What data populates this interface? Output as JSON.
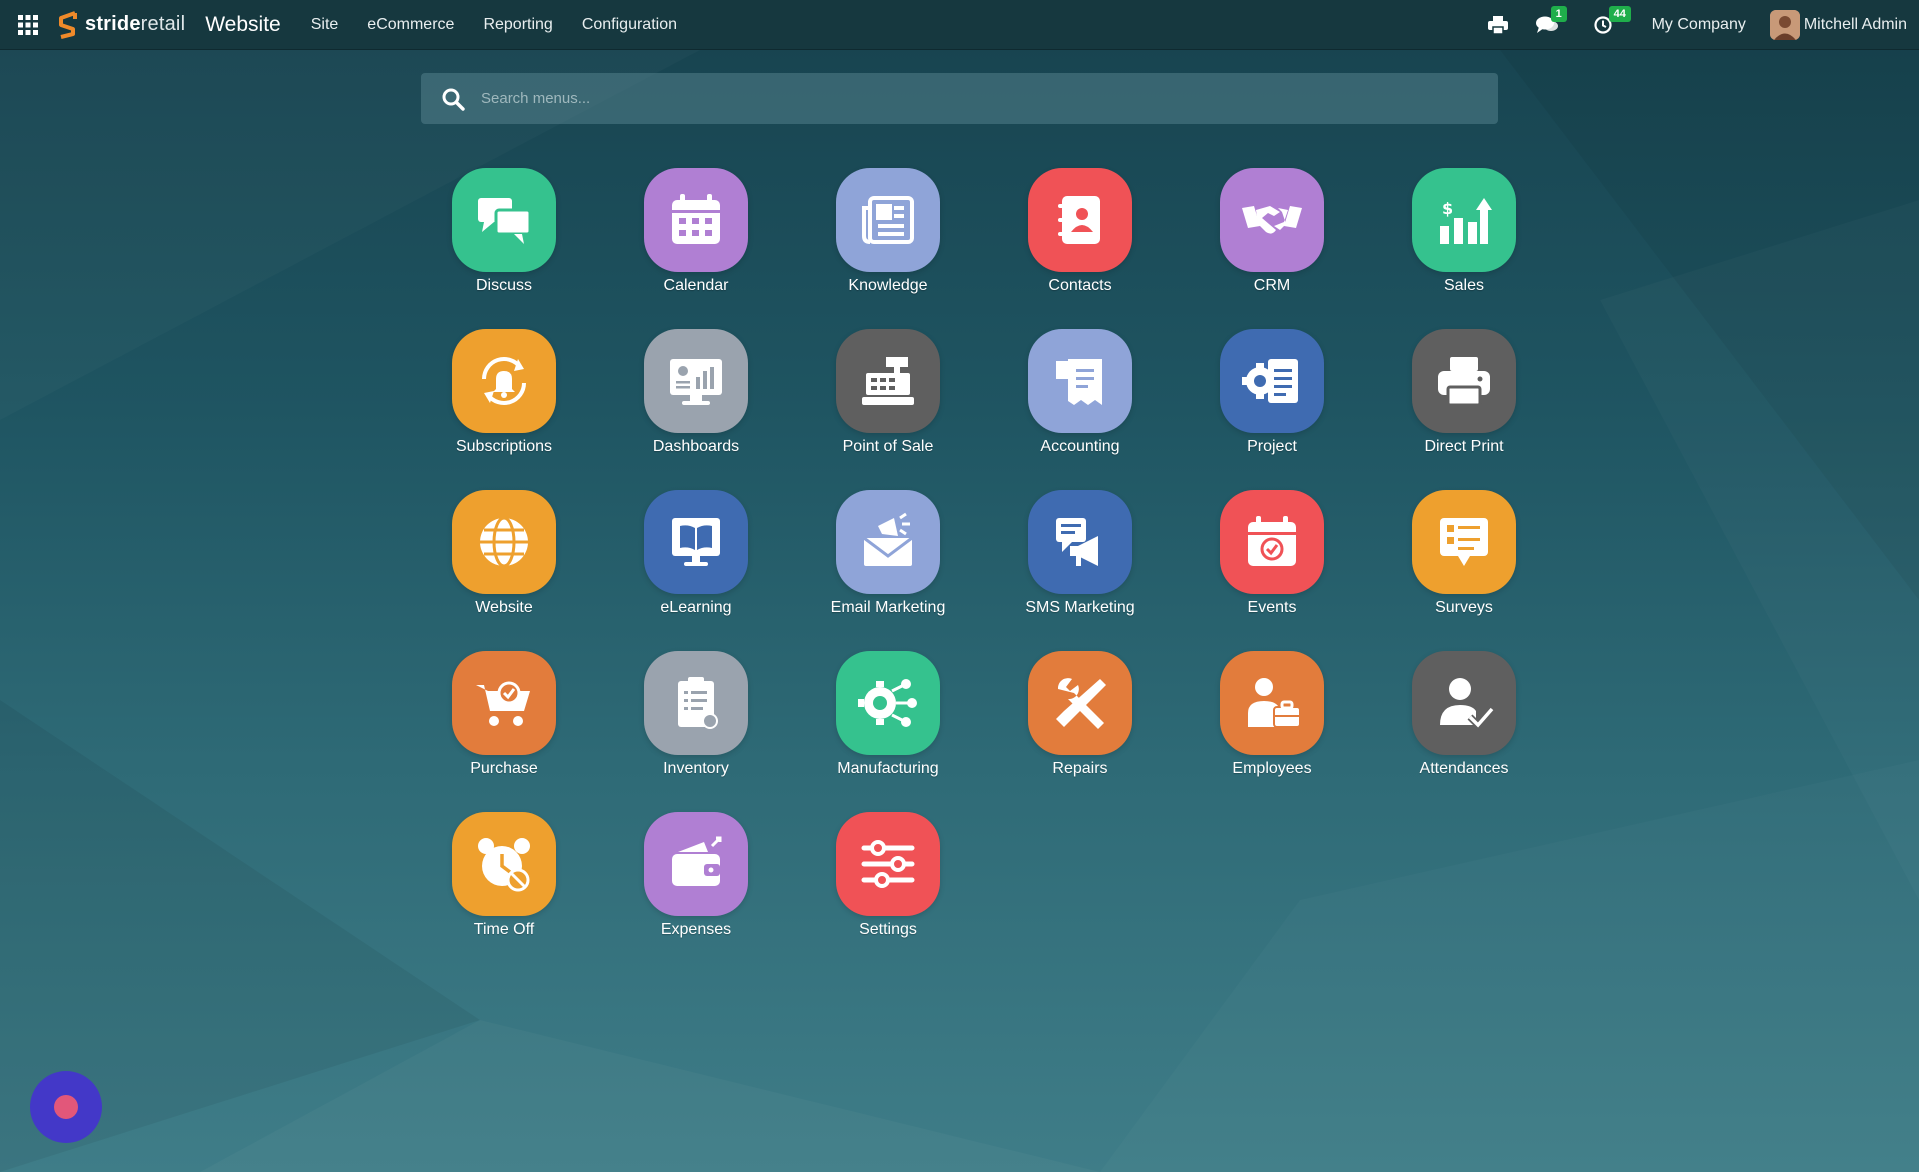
{
  "navbar": {
    "brand": {
      "bold": "stride",
      "light": "retail"
    },
    "app_title": "Website",
    "menu": [
      {
        "label": "Site"
      },
      {
        "label": "eCommerce"
      },
      {
        "label": "Reporting"
      },
      {
        "label": "Configuration"
      }
    ],
    "messages_badge": "1",
    "activities_badge": "44",
    "company": "My Company",
    "user_name": "Mitchell Admin"
  },
  "search": {
    "placeholder": "Search menus..."
  },
  "apps": [
    {
      "label": "Discuss",
      "color": "#35c28e",
      "icon": "chat-bubbles-icon"
    },
    {
      "label": "Calendar",
      "color": "#b07fd3",
      "icon": "calendar-icon"
    },
    {
      "label": "Knowledge",
      "color": "#8fa4d8",
      "icon": "newspaper-icon"
    },
    {
      "label": "Contacts",
      "color": "#f05256",
      "icon": "address-book-icon"
    },
    {
      "label": "CRM",
      "color": "#b07fd3",
      "icon": "handshake-icon"
    },
    {
      "label": "Sales",
      "color": "#35c28e",
      "icon": "chart-growth-icon"
    },
    {
      "label": "Subscriptions",
      "color": "#eea02e",
      "icon": "bell-cycle-icon"
    },
    {
      "label": "Dashboards",
      "color": "#9aa3ae",
      "icon": "monitor-chart-icon"
    },
    {
      "label": "Point of Sale",
      "color": "#5f5f5f",
      "icon": "cash-register-icon"
    },
    {
      "label": "Accounting",
      "color": "#8fa4d8",
      "icon": "receipt-icon"
    },
    {
      "label": "Project",
      "color": "#3f6bb1",
      "icon": "project-gear-icon"
    },
    {
      "label": "Direct Print",
      "color": "#5f5f5f",
      "icon": "printer-icon"
    },
    {
      "label": "Website",
      "color": "#eea02e",
      "icon": "globe-icon"
    },
    {
      "label": "eLearning",
      "color": "#3f6bb1",
      "icon": "open-book-icon"
    },
    {
      "label": "Email Marketing",
      "color": "#8fa4d8",
      "icon": "envelope-megaphone-icon"
    },
    {
      "label": "SMS Marketing",
      "color": "#3f6bb1",
      "icon": "sms-megaphone-icon"
    },
    {
      "label": "Events",
      "color": "#f05256",
      "icon": "calendar-check-icon"
    },
    {
      "label": "Surveys",
      "color": "#eea02e",
      "icon": "survey-icon"
    },
    {
      "label": "Purchase",
      "color": "#e27c3c",
      "icon": "shopping-cart-icon"
    },
    {
      "label": "Inventory",
      "color": "#9aa3ae",
      "icon": "clipboard-icon"
    },
    {
      "label": "Manufacturing",
      "color": "#35c28e",
      "icon": "gear-network-icon"
    },
    {
      "label": "Repairs",
      "color": "#e27c3c",
      "icon": "tools-icon"
    },
    {
      "label": "Employees",
      "color": "#e27c3c",
      "icon": "employee-briefcase-icon"
    },
    {
      "label": "Attendances",
      "color": "#5f5f5f",
      "icon": "user-check-icon"
    },
    {
      "label": "Time Off",
      "color": "#eea02e",
      "icon": "alarm-clock-icon"
    },
    {
      "label": "Expenses",
      "color": "#b07fd3",
      "icon": "wallet-icon"
    },
    {
      "label": "Settings",
      "color": "#f05256",
      "icon": "sliders-icon"
    }
  ]
}
